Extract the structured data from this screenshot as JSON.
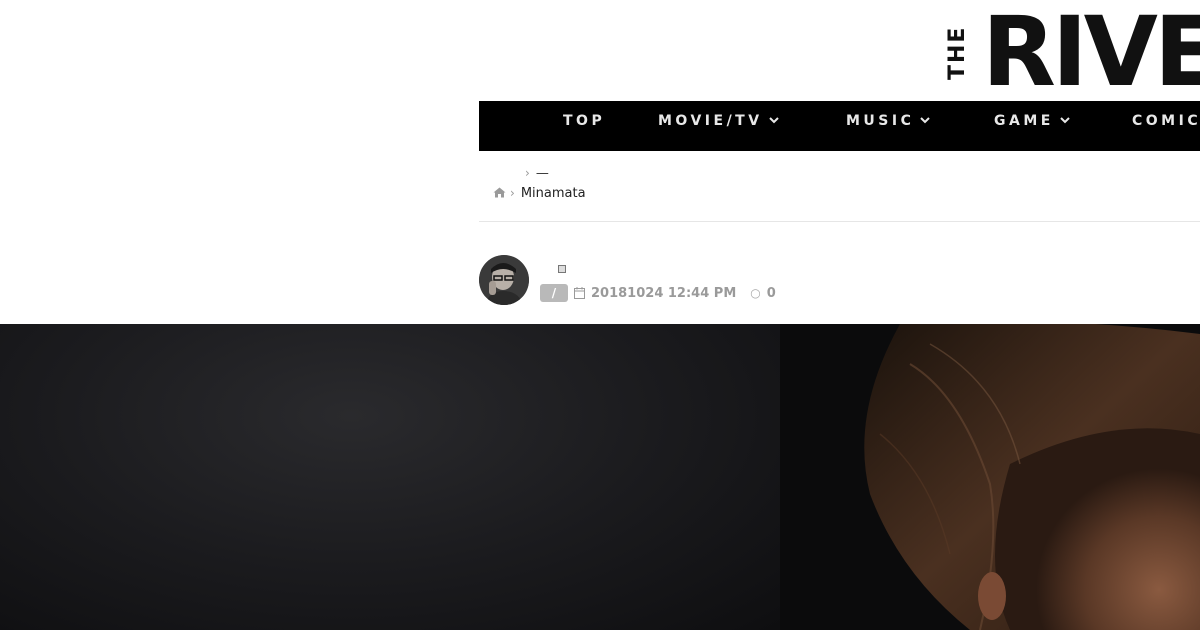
{
  "logo": {
    "the": "THE",
    "main": "RIVE"
  },
  "nav": {
    "items": [
      {
        "label": "TOP",
        "has_dropdown": false
      },
      {
        "label": "MOVIE/TV",
        "has_dropdown": true
      },
      {
        "label": "MUSIC",
        "has_dropdown": true
      },
      {
        "label": "GAME",
        "has_dropdown": true
      },
      {
        "label": "COMIC",
        "has_dropdown": false
      }
    ],
    "chevron": "⌄"
  },
  "breadcrumb": {
    "row1_text": "—",
    "current": "Minamata"
  },
  "meta": {
    "category_badge": "/",
    "date": "20181024 12:44 PM",
    "comments": "0"
  },
  "colors": {
    "nav_bg": "#000000",
    "nav_text": "#e8e8e8",
    "meta_text": "#9a9a9a",
    "badge_bg": "#b9b9b9"
  },
  "icons": {
    "home": "home-icon",
    "calendar": "calendar-icon",
    "comment": "comment-icon",
    "chevron": "chevron-right-icon"
  }
}
